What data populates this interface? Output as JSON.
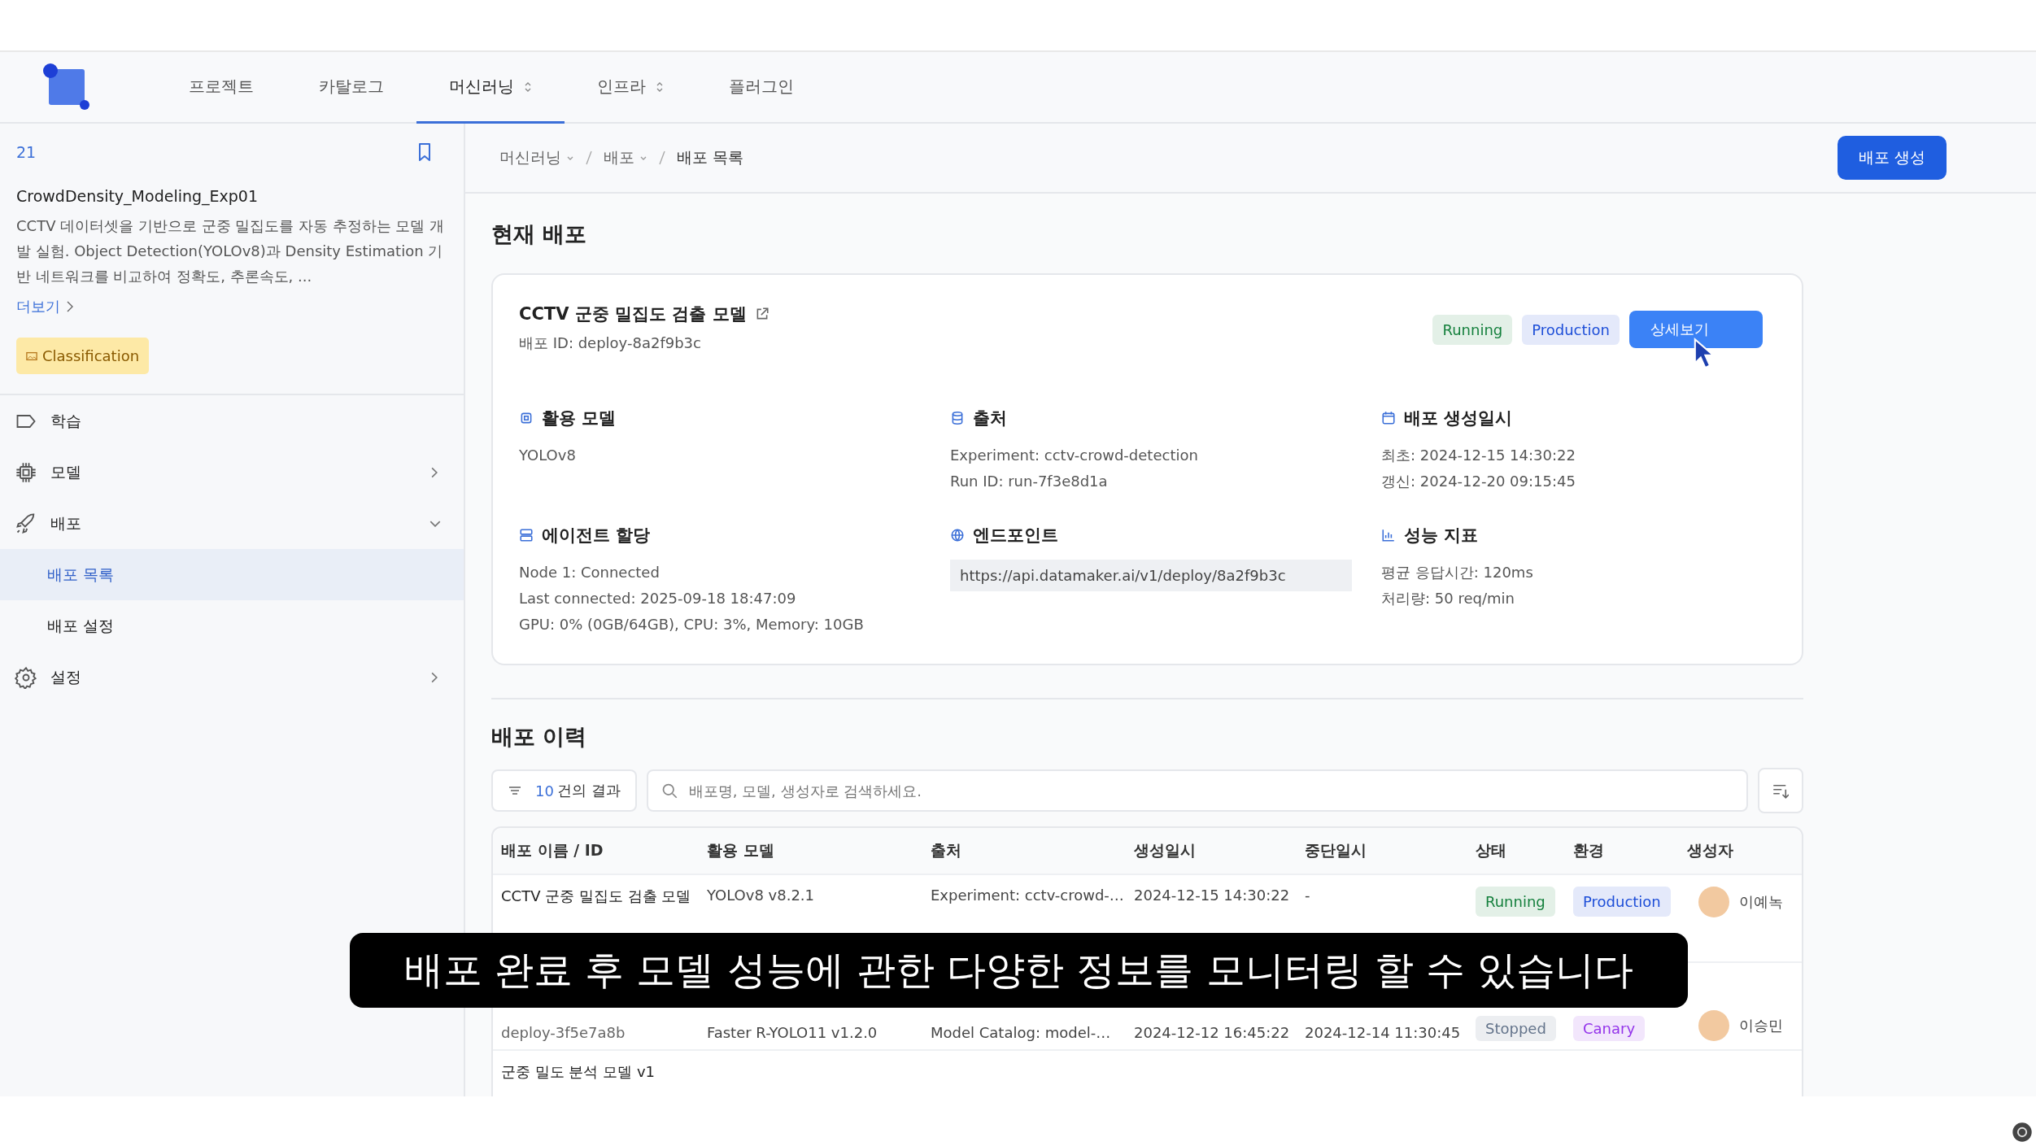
{
  "nav": {
    "items": [
      {
        "label": "프로젝트",
        "selected": false,
        "dropdown": false
      },
      {
        "label": "카탈로그",
        "selected": false,
        "dropdown": false
      },
      {
        "label": "머신러닝",
        "selected": true,
        "dropdown": true
      },
      {
        "label": "인프라",
        "selected": false,
        "dropdown": true
      },
      {
        "label": "플러그인",
        "selected": false,
        "dropdown": false
      }
    ]
  },
  "sidebar": {
    "project_number": "21",
    "title": "CrowdDensity_Modeling_Exp01",
    "description": "CCTV 데이터셋을 기반으로 군중 밀집도를 자동 추정하는 모델 개발 실험. Object Detection(YOLOv8)과 Density Estimation 기반 네트워크를 비교하여 정확도, 추론속도, ...",
    "more_link": "더보기",
    "tag": "Classification",
    "menu": [
      {
        "kind": "training",
        "label": "학습",
        "expandable": false
      },
      {
        "kind": "model",
        "label": "모델",
        "expandable": true,
        "expanded": false
      },
      {
        "kind": "deploy",
        "label": "배포",
        "expandable": true,
        "expanded": true,
        "children": [
          {
            "label": "배포 목록",
            "selected": true
          },
          {
            "label": "배포 설정",
            "selected": false
          }
        ]
      },
      {
        "kind": "settings",
        "label": "설정",
        "expandable": true,
        "expanded": false
      }
    ]
  },
  "breadcrumb": [
    {
      "label": "머신러닝",
      "dropdown": true
    },
    {
      "label": "배포",
      "dropdown": true
    },
    {
      "label": "배포 목록",
      "dropdown": false
    }
  ],
  "create_button": "배포 생성",
  "current": {
    "title": "현재 배포",
    "card": {
      "name": "CCTV 군중 밀집도 검출 모델",
      "deploy_id": "배포 ID: deploy-8a2f9b3c",
      "status": {
        "label": "Running",
        "color": "#15803d"
      },
      "environment": {
        "label": "Production",
        "color": "#1d4ed8"
      },
      "detail_button": "상세보기",
      "sections": [
        {
          "kind": "model",
          "title": "활용 모델",
          "lines": [
            "YOLOv8"
          ]
        },
        {
          "kind": "source",
          "title": "출처",
          "lines": [
            "Experiment: cctv-crowd-detection",
            "Run ID: run-7f3e8d1a"
          ]
        },
        {
          "kind": "date",
          "title": "배포 생성일시",
          "lines": [
            "최초: 2024-12-15 14:30:22",
            "갱신: 2024-12-20 09:15:45"
          ]
        },
        {
          "kind": "agent",
          "title": "에이전트 할당",
          "lines": [
            "Node 1: Connected",
            "Last connected: 2025-09-18 18:47:09",
            "GPU: 0% (0GB/64GB), CPU: 3%, Memory: 10GB"
          ]
        },
        {
          "kind": "endpoint",
          "title": "엔드포인트",
          "url": "https://api.datamaker.ai/v1/deploy/8a2f9b3c"
        },
        {
          "kind": "metrics",
          "title": "성능 지표",
          "lines": [
            "평균 응답시간: 120ms",
            "처리량: 50 req/min"
          ]
        }
      ]
    }
  },
  "history": {
    "title": "배포 이력",
    "result_count": "10",
    "result_suffix": "건의 결과",
    "search_placeholder": "배포명, 모델, 생성자로 검색하세요.",
    "columns": [
      "배포 이름 / ID",
      "활용 모델",
      "출처",
      "생성일시",
      "중단일시",
      "상태",
      "환경",
      "생성자"
    ],
    "rows": [
      {
        "name": "CCTV 군중 밀집도 검출 모델",
        "model": "YOLOv8 v8.2.1",
        "source": "Experiment: cctv-crowd-…",
        "created": "2024-12-15 14:30:22",
        "stopped": "-",
        "status": {
          "label": "Running",
          "color": "#15803d"
        },
        "environment": {
          "label": "Production",
          "color": "#1d4ed8"
        },
        "creator": "이예녹"
      },
      {
        "id": "deploy-3f5e7a8b",
        "model": "Faster R-YOLO11 v1.2.0",
        "source": "Model Catalog: model-…",
        "created": "2024-12-12 16:45:22",
        "stopped": "2024-12-14 11:30:45",
        "status": {
          "label": "Stopped",
          "color": "#64748b"
        },
        "environment": {
          "label": "Canary",
          "color": "#9333ea"
        },
        "creator": "이승민"
      },
      {
        "name": "군중 밀도 분석 모델 v1"
      }
    ]
  },
  "subtitle": "배포 완료 후 모델 성능에 관한 다양한 정보를 모니터링 할 수 있습니다"
}
